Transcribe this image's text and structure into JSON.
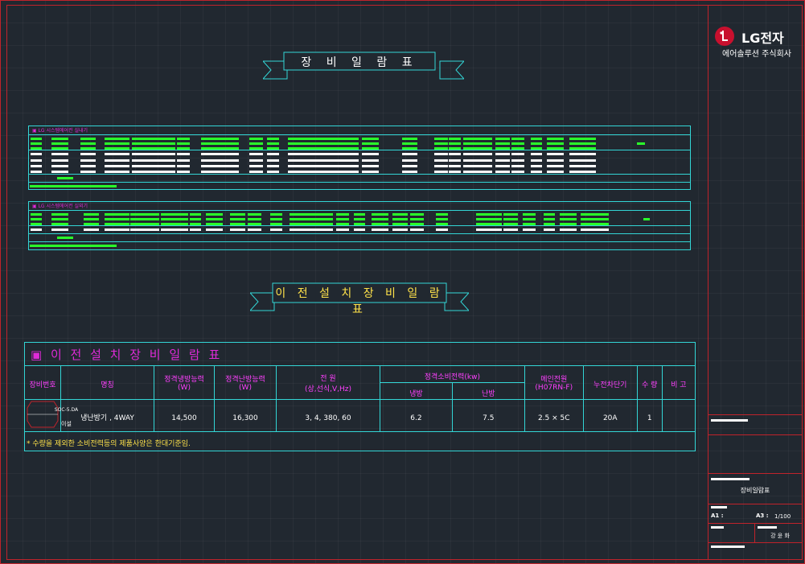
{
  "logo": {
    "brand": "LG전자",
    "subtitle": "에어솔루션 주식회사"
  },
  "banners": {
    "equipment_list": "장 비 일 람 표",
    "relocated_list": "이 전 설 치 장 비 일 람 표"
  },
  "schedule1_label": "▣ LG 시스템에어컨 실내기",
  "schedule2_label": "▣ LG 시스템에어컨 실외기",
  "relocation_table": {
    "title": "▣ 이 전 설 치 장 비 일 람 표",
    "headers": {
      "id": "장비번호",
      "name": "명칭",
      "cooling": "정격냉방능력",
      "cooling_unit": "(W)",
      "heating": "정격난방능력",
      "heating_unit": "(W)",
      "power": "전 원",
      "power_sub": "(상,선식,V,Hz)",
      "consumption": "정격소비전력(kw)",
      "cons_cool": "냉방",
      "cons_heat": "난방",
      "main_power": "메인전원",
      "main_power_sub": "(H07RN-F)",
      "breaker": "누전차단기",
      "qty": "수 량",
      "remarks": "비 고"
    },
    "row": {
      "id": "SOC-5.DA",
      "tag": "이설",
      "name": "냉난방기 , 4WAY",
      "cooling": "14,500",
      "heating": "16,300",
      "power": "3, 4, 380, 60",
      "cons_cool": "6.2",
      "cons_heat": "7.5",
      "main_power": "2.5 × 5C",
      "breaker": "20A",
      "qty": "1",
      "remarks": ""
    },
    "note": "* 수량을 제외한 소비전력등의 제품사양은 한대기준임."
  },
  "title_block": {
    "drawing_title": "장비일람표",
    "size_a1": "A1 :",
    "size_a3": "A3 :",
    "scale": "1/100",
    "drafter": "강 윤 화"
  },
  "colors": {
    "background": "#212830",
    "frame": "#c0232b",
    "table_line": "#33d6d6",
    "accent_text": "#ff40ff",
    "note_text": "#ffe24a",
    "lg_red": "#c8102e"
  }
}
